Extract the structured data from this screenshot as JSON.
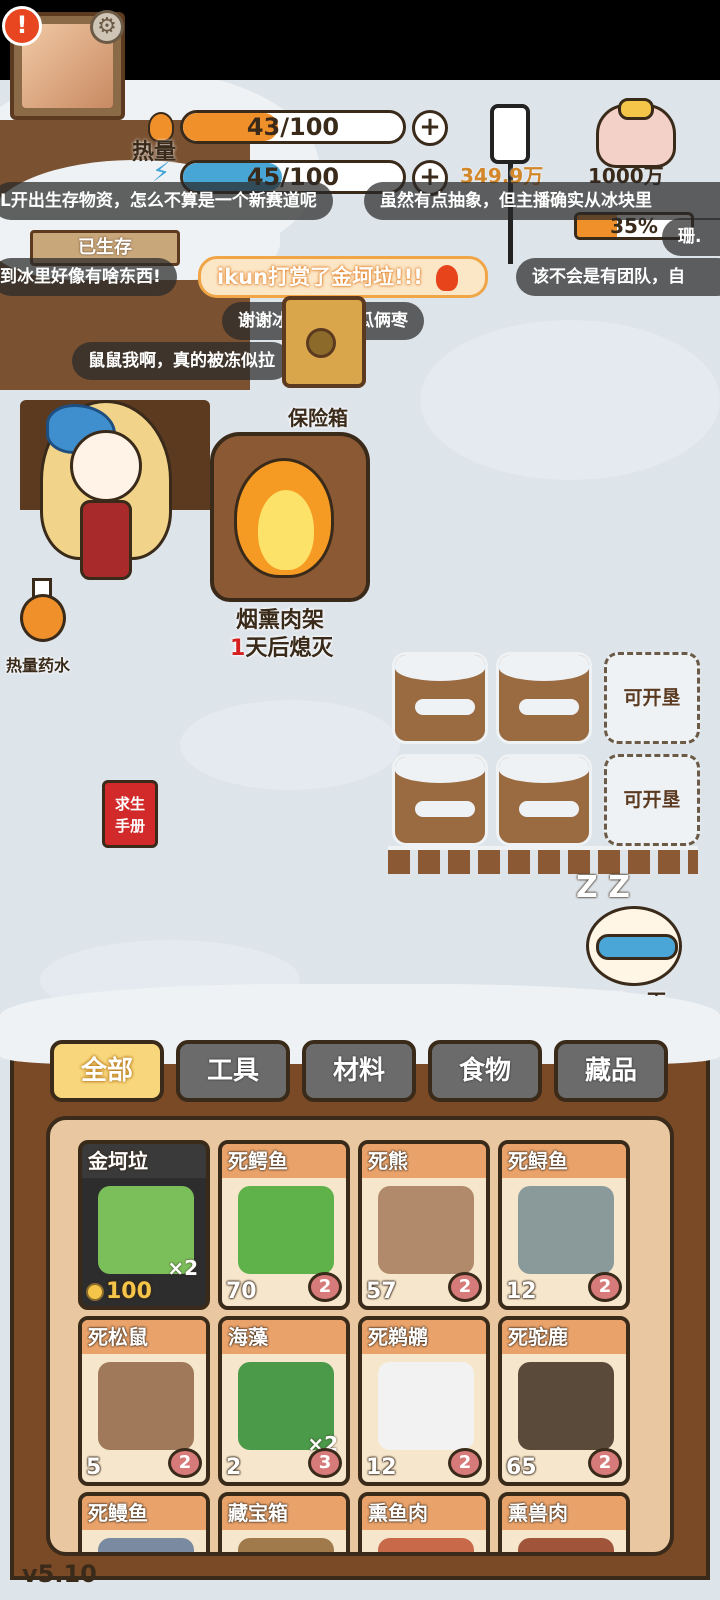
{
  "hud": {
    "heat_label": "热量",
    "heat_value": "43/100",
    "heat_fraction": 0.43,
    "water_value": "45/100",
    "water_fraction": 0.45,
    "plus": "+",
    "viewers": "349.9万",
    "goal": "1000万",
    "goal_percent": "35%",
    "goal_fraction": 0.35,
    "alert": "!",
    "gear": "⚙"
  },
  "danmaku": [
    "L开出生存物资，怎么不算是一个新赛道呢",
    "虽然有点抽象，但主播确实从冰块里",
    "珊.",
    "到冰里好像有啥东西!",
    "该不会是有团队，自",
    "谢谢冰哥给的仨瓜俩枣",
    "鼠鼠我啊，真的被冻似拉"
  ],
  "gift_message": "ikun打赏了金坷垃!!!",
  "house": {
    "sign": "已生存"
  },
  "safe_label": "保险箱",
  "smoker": {
    "name": "烟熏肉架",
    "days_num": "1",
    "days_text": "天后熄灭"
  },
  "potion_label": "热量药水",
  "manual": {
    "line1": "求生",
    "line2": "手册"
  },
  "plot_locked": "可开垦",
  "next_day": "下一天",
  "zzz": "Z Z",
  "tabs": [
    "全部",
    "工具",
    "材料",
    "食物",
    "藏品"
  ],
  "items": [
    {
      "name": "金坷垃",
      "count": "100",
      "qty": "×2",
      "price_coin": true
    },
    {
      "name": "死鳄鱼",
      "count": "70",
      "badge": "2"
    },
    {
      "name": "死熊",
      "count": "57",
      "badge": "2"
    },
    {
      "name": "死鲟鱼",
      "count": "12",
      "badge": "2"
    },
    {
      "name": "死松鼠",
      "count": "5",
      "badge": "2"
    },
    {
      "name": "海藻",
      "count": "2",
      "badge": "3",
      "qty": "×2"
    },
    {
      "name": "死鹈鹕",
      "count": "12",
      "badge": "2"
    },
    {
      "name": "死驼鹿",
      "count": "65",
      "badge": "2"
    },
    {
      "name": "死鳗鱼"
    },
    {
      "name": "藏宝箱"
    },
    {
      "name": "熏鱼肉"
    },
    {
      "name": "熏兽肉"
    }
  ],
  "version": "v5.10",
  "colors": {
    "heat": "#f0902a",
    "water": "#48a6d6",
    "gold": "#f8d77c"
  }
}
